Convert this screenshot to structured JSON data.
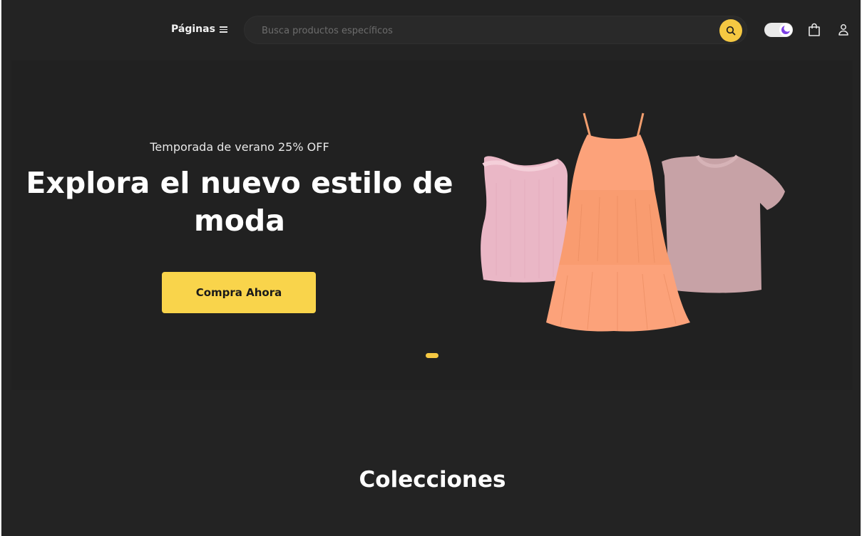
{
  "header": {
    "pages_label": "Páginas",
    "search_placeholder": "Busca productos específicos"
  },
  "hero": {
    "subtitle": "Temporada de verano 25% OFF",
    "title": "Explora el nuevo estilo de moda",
    "cta_label": "Compra Ahora",
    "slides_count": 1,
    "active_slide": 1,
    "products": [
      "pink-tank-top",
      "orange-dress",
      "mauve-tshirt"
    ]
  },
  "collections": {
    "title": "Colecciones"
  },
  "colors": {
    "background": "#232323",
    "accent": "#F9D44B",
    "toggle_moon": "#7B3FE4"
  },
  "icons": [
    "menu-icon",
    "search-icon",
    "moon-icon",
    "shopping-bag-icon",
    "user-icon"
  ]
}
